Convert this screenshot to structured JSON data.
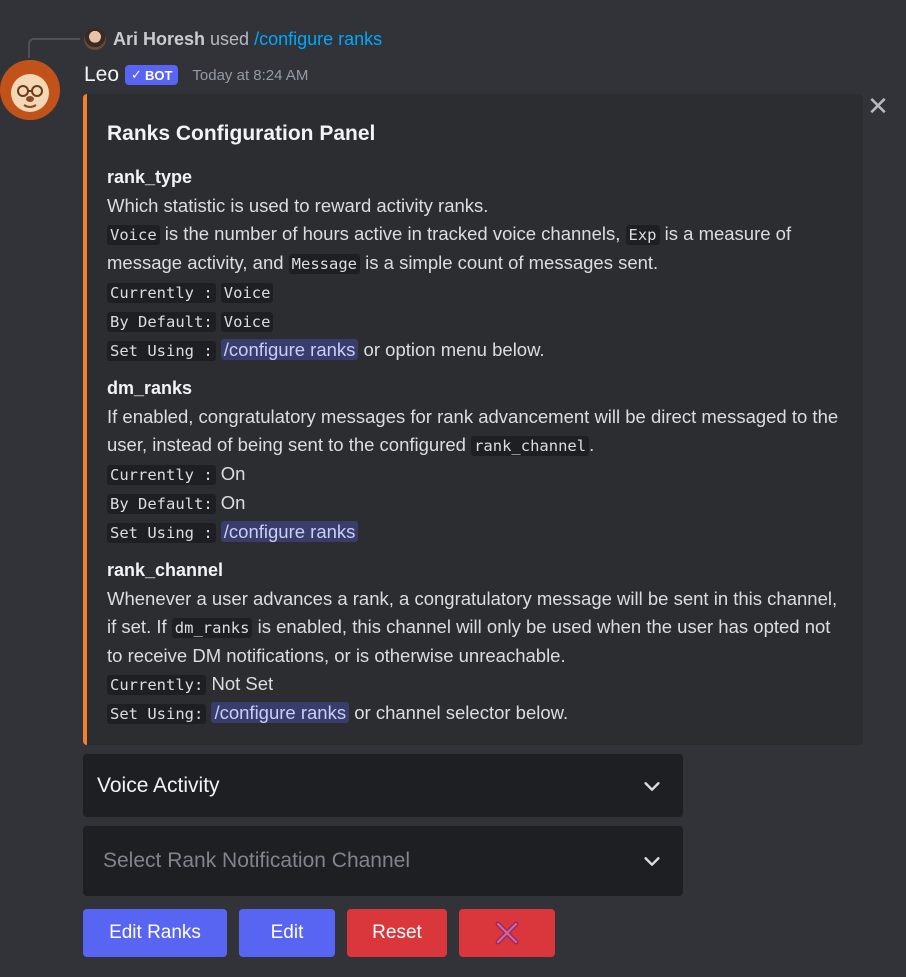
{
  "reply": {
    "author": "Ari Horesh",
    "used": "used",
    "command": "/configure ranks"
  },
  "message": {
    "author": "Leo",
    "bot_badge": "BOT",
    "timestamp": "Today at 8:24 AM"
  },
  "embed": {
    "accent_color": "#f0822d",
    "title": "Ranks Configuration Panel",
    "fields": [
      {
        "name": "rank_type",
        "desc_line1": "Which statistic is used to reward activity ranks.",
        "code_voice": "Voice",
        "text_a": " is the number of hours active in tracked voice channels, ",
        "code_exp": "Exp",
        "text_b": " is a measure of message activity, and ",
        "code_message": "Message",
        "text_c": " is a simple count of messages sent.",
        "currently_label": "Currently :",
        "currently_value": "Voice",
        "default_label": "By Default:",
        "default_value": "Voice",
        "setusing_label": "Set Using :",
        "setusing_cmd": "/configure ranks",
        "setusing_suffix": " or option menu below."
      },
      {
        "name": "dm_ranks",
        "text_a": "If enabled, congratulatory messages for rank advancement will be direct messaged to the user, instead of being sent to the configured ",
        "code_channel": "rank_channel",
        "text_b": ".",
        "currently_label": "Currently :",
        "currently_value": "On",
        "default_label": "By Default:",
        "default_value": "On",
        "setusing_label": "Set Using :",
        "setusing_cmd": "/configure ranks"
      },
      {
        "name": "rank_channel",
        "text_a": "Whenever a user advances a rank, a congratulatory message will be sent in this channel, if set. If ",
        "code_dm": "dm_ranks",
        "text_b": " is enabled, this channel will only be used when the user has opted not to receive DM notifications, or is otherwise unreachable.",
        "currently_label": "Currently:",
        "currently_value": "Not Set",
        "setusing_label": "Set Using:",
        "setusing_cmd": "/configure ranks",
        "setusing_suffix": " or channel selector below."
      }
    ]
  },
  "selects": {
    "rank_type_value": "Voice Activity",
    "channel_placeholder": "Select Rank Notification Channel"
  },
  "buttons": {
    "edit_ranks": "Edit Ranks",
    "edit": "Edit",
    "reset": "Reset",
    "close_icon": "cross-mark-icon"
  },
  "colors": {
    "blurple": "#5865f2",
    "danger": "#da373c",
    "link": "#00a8fc"
  }
}
